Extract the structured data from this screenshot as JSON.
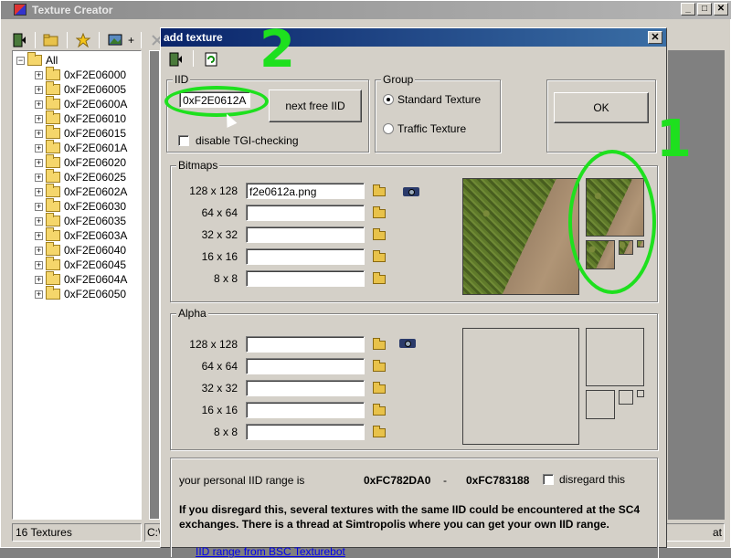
{
  "main_window": {
    "title": "Texture Creator",
    "window_buttons": [
      "_",
      "□",
      "✕"
    ],
    "toolbar_add_label": "+"
  },
  "tree": {
    "root": "All",
    "items": [
      "0xF2E06000",
      "0xF2E06005",
      "0xF2E0600A",
      "0xF2E06010",
      "0xF2E06015",
      "0xF2E0601A",
      "0xF2E06020",
      "0xF2E06025",
      "0xF2E0602A",
      "0xF2E06030",
      "0xF2E06035",
      "0xF2E0603A",
      "0xF2E06040",
      "0xF2E06045",
      "0xF2E0604A",
      "0xF2E06050"
    ]
  },
  "status": {
    "count": "16 Textures",
    "path_fragment": "C:\\",
    "right_fragment": "at"
  },
  "dialog": {
    "title": "add texture",
    "close_label": "✕",
    "iid": {
      "group_label": "IID",
      "value": "0xF2E0612A",
      "next_free_label": "next free IID",
      "disable_tgi_label": "disable TGI-checking"
    },
    "group": {
      "label": "Group",
      "options": [
        "Standard Texture",
        "Traffic Texture"
      ],
      "selected": 0
    },
    "ok_label": "OK",
    "bitmaps": {
      "label": "Bitmaps",
      "sizes": [
        "128 x 128",
        "64 x 64",
        "32 x 32",
        "16 x 16",
        "8 x 8"
      ],
      "files": [
        "f2e0612a.png",
        "",
        "",
        "",
        ""
      ]
    },
    "alpha": {
      "label": "Alpha",
      "sizes": [
        "128 x 128",
        "64 x 64",
        "32 x 32",
        "16 x 16",
        "8 x 8"
      ]
    },
    "range": {
      "label": "your personal IID range is",
      "from": "0xFC782DA0",
      "dash": "-",
      "to": "0xFC783188",
      "disregard_label": "disregard this"
    },
    "warning": "If you disregard this, several textures with the same IID could be encountered at the SC4 exchanges. There is a thread at Simtropolis where you can get your own IID range.",
    "link_fragment": "IID range from BSC Texturebot"
  },
  "annotations": {
    "num1": "1",
    "num2": "2",
    "color": "#1ee01e"
  }
}
